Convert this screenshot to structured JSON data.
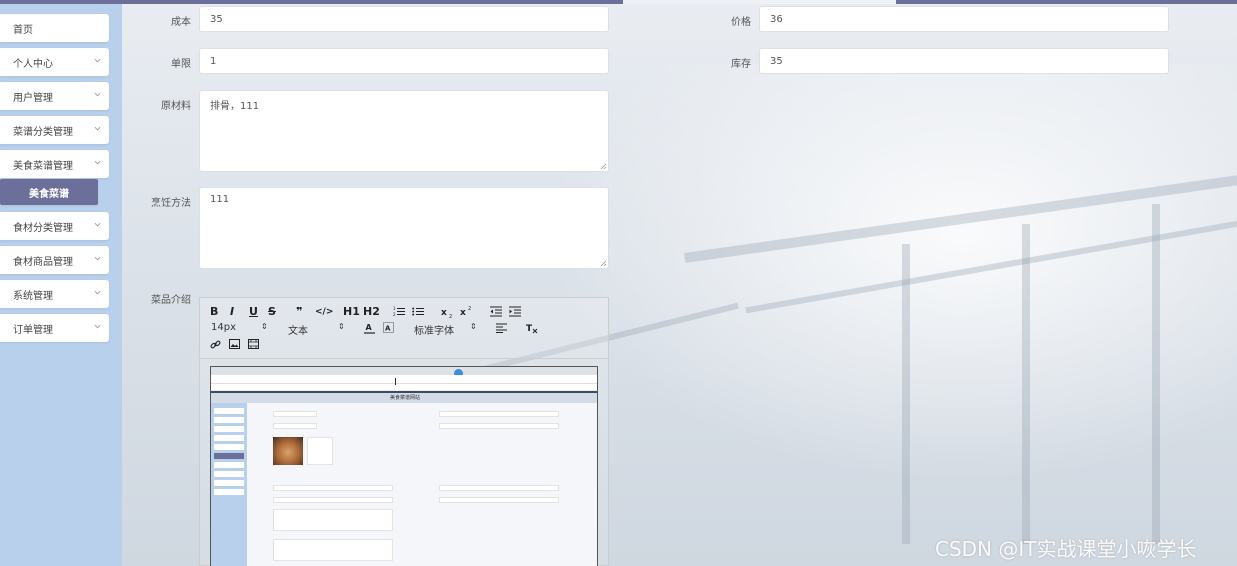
{
  "sidebar": {
    "items": [
      {
        "label": "首页",
        "has_chevron": false
      },
      {
        "label": "个人中心",
        "has_chevron": true
      },
      {
        "label": "用户管理",
        "has_chevron": true
      },
      {
        "label": "菜谱分类管理",
        "has_chevron": true
      },
      {
        "label": "美食菜谱管理",
        "has_chevron": true
      },
      {
        "label": "美食菜谱",
        "active": true
      },
      {
        "label": "食材分类管理",
        "has_chevron": true
      },
      {
        "label": "食材商品管理",
        "has_chevron": true
      },
      {
        "label": "系统管理",
        "has_chevron": true
      },
      {
        "label": "订单管理",
        "has_chevron": true
      }
    ],
    "active_color": "#6b6f9a",
    "bg_color": "#b8d0ec"
  },
  "form": {
    "cost": {
      "label": "成本",
      "value": "35"
    },
    "price": {
      "label": "价格",
      "value": "36"
    },
    "limit": {
      "label": "单限",
      "value": "1"
    },
    "stock": {
      "label": "库存",
      "value": "35"
    },
    "ingredients": {
      "label": "原材料",
      "value": "排骨，111"
    },
    "method": {
      "label": "烹饪方法",
      "value": "111"
    },
    "intro": {
      "label": "菜品介绍"
    }
  },
  "editor": {
    "toolbar": {
      "bold": "B",
      "italic": "I",
      "underline": "U",
      "strike": "S",
      "quote": "❞",
      "code": "</>",
      "h1": "H1",
      "h2": "H2",
      "font_size": "14px",
      "text_type": "文本",
      "font_family": "标准字体"
    },
    "embedded_screenshot": {
      "header_title": "美食菜谱网站"
    }
  },
  "watermark": "CSDN @IT实战课堂小咴学长"
}
